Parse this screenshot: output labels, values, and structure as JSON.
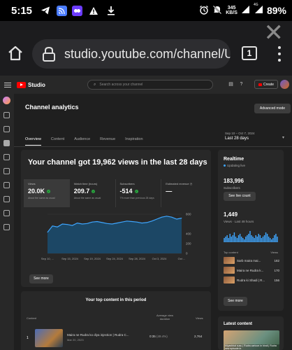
{
  "status_bar": {
    "time": "5:15",
    "net_speed": "345",
    "net_unit": "KB/S",
    "signal_label": "4G",
    "battery": "89%"
  },
  "browser": {
    "url": "studio.youtube.com/channel/UCV2p",
    "tab_count": "1"
  },
  "studio": {
    "logo_text": "Studio",
    "search_placeholder": "Search across your channel",
    "create_label": "Create"
  },
  "analytics": {
    "title": "Channel analytics",
    "advanced_mode": "Advanced mode",
    "date_range": "Sep 10 – Oct 7, 2024",
    "date_selection": "Last 28 days",
    "tabs": [
      {
        "label": "Overview",
        "active": true
      },
      {
        "label": "Content",
        "active": false
      },
      {
        "label": "Audience",
        "active": false
      },
      {
        "label": "Revenue",
        "active": false
      },
      {
        "label": "Inspiration",
        "active": false
      }
    ],
    "headline": "Your channel got 19,962 views in the last 28 days",
    "metrics": [
      {
        "label": "Views",
        "value": "20.0K",
        "sub": "About the same as usual"
      },
      {
        "label": "Watch time (hours)",
        "value": "209.7",
        "sub": "About the same as usual"
      },
      {
        "label": "Subscribers",
        "value": "-514",
        "sub": "7% more than previous 28 days"
      },
      {
        "label": "Estimated revenue",
        "value": "—",
        "sub": ""
      }
    ],
    "see_more": "See more"
  },
  "chart_data": {
    "type": "area",
    "x": [
      "Sep 10, ...",
      "Sep 15, 2024",
      "Sep 19, 2024",
      "Sep 24, 2024",
      "Sep 28, 2024",
      "Oct 3, 2024",
      "Oct ..."
    ],
    "values": [
      430,
      560,
      540,
      600,
      590,
      570,
      620,
      600,
      610,
      640,
      650,
      630,
      610,
      600,
      620,
      640,
      660,
      650,
      640,
      620,
      630,
      660,
      700,
      740,
      760,
      740,
      700,
      720
    ],
    "y_ticks": [
      "800",
      "400",
      "200",
      "0"
    ],
    "ylim": [
      0,
      800
    ],
    "color": "#3ea6ff"
  },
  "realtime": {
    "title": "Realtime",
    "status": "Updating live",
    "subscribers": "183,996",
    "subscribers_label": "Subscribers",
    "live_count_button": "See live count",
    "views": "1,449",
    "views_label": "Views · Last 48 hours",
    "top_content_label": "Top content",
    "views_col": "Views",
    "items": [
      {
        "title": "Sarb maira mai...",
        "views": "182"
      },
      {
        "title": "Maira ne Rudra k...",
        "views": "170"
      },
      {
        "title": "Rudra ki Shadi | R...",
        "views": "156"
      }
    ],
    "see_more": "See more"
  },
  "top_content": {
    "title": "Your top content in this period",
    "col_content": "Content",
    "col_avd": "Average view duration",
    "col_views": "Views",
    "rows": [
      {
        "rank": "1",
        "title": "Maira ne Rudra ko diya injection | Rudra C...",
        "date": "Mar 20, 2023",
        "avd": "0:35",
        "pct": "(49.4%)",
        "views": "2,764"
      }
    ]
  },
  "latest_content": {
    "title": "Latest content",
    "caption": "Miyanbhai susu | Rudra cartoon in hindi | Rudra new episode in"
  }
}
